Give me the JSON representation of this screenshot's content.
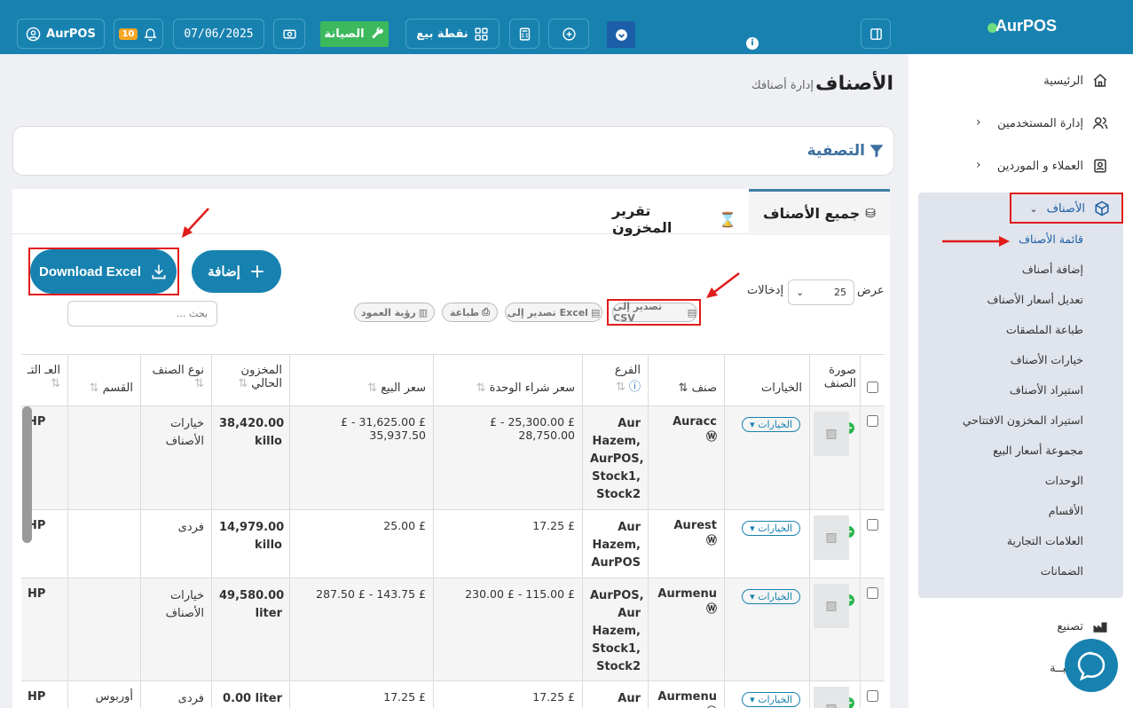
{
  "app": {
    "brand": "AurPOS",
    "page_title": "الأصناف",
    "page_subtitle": "إدارة أصنافك"
  },
  "topbar": {
    "user": "AurPOS",
    "notif_count": "10",
    "date": "07/06/2025",
    "maintenance": "الصيانة",
    "pos": "نقطة بيع"
  },
  "sidebar": {
    "items": [
      {
        "label": "الرئيسية",
        "icon": "home-icon"
      },
      {
        "label": "إدارة المستخدمين",
        "icon": "users-icon"
      },
      {
        "label": "العملاء و الموردين",
        "icon": "contacts-icon"
      },
      {
        "label": "الأصناف",
        "icon": "box-icon"
      },
      {
        "label": "تصنيع",
        "icon": "factory-icon"
      },
      {
        "label": "ـــبــة",
        "icon": "calc-icon"
      }
    ],
    "sub_items": [
      "قائمة الأصناف",
      "إضافة أصناف",
      "تعديل أسعار الأصناف",
      "طباعة الملصقات",
      "خيارات الأصناف",
      "استيراد الأصناف",
      "استيراد المخزون الافتتاحي",
      "مجموعة أسعار البيع",
      "الوحدات",
      "الأقسام",
      "العلامات التجارية",
      "الضمانات"
    ]
  },
  "filter": {
    "label": "التصفية"
  },
  "tabs": {
    "all": "جميع الأصناف",
    "stock": "تقرير المخزون"
  },
  "actions": {
    "add": "إضافة",
    "download_excel": "Download Excel",
    "show": "عرض",
    "entries": "إدخالات",
    "page_size": "25",
    "search_placeholder": "بحث ...",
    "csv": "تصدير إلى CSV",
    "excel": "تصدير إلى Excel",
    "print": "طباعة",
    "columns": "رؤية العمود"
  },
  "table": {
    "headers": [
      "صورة الصنف",
      "الخيارات",
      "صنف",
      "الفرع",
      "سعر شراء الوحدة",
      "سعر البيع",
      "المخزون الحالي",
      "نوع الصنف",
      "القسم",
      "العـ التـ"
    ],
    "options_label": "الخيارات",
    "rows": [
      {
        "name": "Auracc",
        "branch": "Aur Hazem, AurPOS, Stock1, Stock2",
        "purchase": "£ 25,300.00 - £ 28,750.00",
        "sell": "£ 31,625.00 - £ 35,937.50",
        "stock": "38,420.00 killo",
        "type": "خيارات الأصناف",
        "category": "",
        "brand": "HP"
      },
      {
        "name": "Aurest",
        "branch": "Aur Hazem, AurPOS",
        "purchase": "£ 17.25",
        "sell": "£ 25.00",
        "stock": "14,979.00 killo",
        "type": "فردى",
        "category": "",
        "brand": "HP"
      },
      {
        "name": "Aurmenu",
        "branch": "AurPOS, Aur Hazem, Stock1, Stock2",
        "purchase": "£ 115.00 - £ 230.00",
        "sell": "£ 143.75 - £ 287.50",
        "stock": "49,580.00 liter",
        "type": "خيارات الأصناف",
        "category": "",
        "brand": "HP"
      },
      {
        "name": "Aurmenu",
        "branch": "Aur",
        "purchase": "£ 17.25",
        "sell": "£ 17.25",
        "stock": "0.00 liter",
        "type": "فردى",
        "category": "أوربوس",
        "brand": "HP"
      }
    ]
  }
}
